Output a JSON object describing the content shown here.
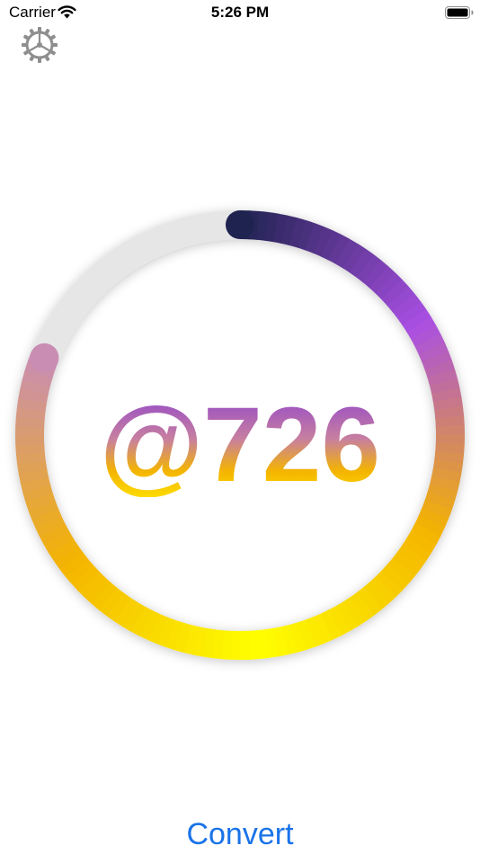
{
  "status_bar": {
    "carrier": "Carrier",
    "time": "5:26 PM",
    "wifi_icon": "wifi-icon",
    "battery_icon": "battery-icon"
  },
  "toolbar": {
    "settings_icon": "gear-icon"
  },
  "progress": {
    "label": "@726",
    "fraction": 0.81,
    "track_color": "#e6e6e6",
    "gradient_colors": [
      "#1f2350",
      "#a94fe3",
      "#f4b400",
      "#ffff00",
      "#f4b400",
      "#c98db4"
    ]
  },
  "action": {
    "convert_label": "Convert",
    "color": "#1a73e8"
  }
}
